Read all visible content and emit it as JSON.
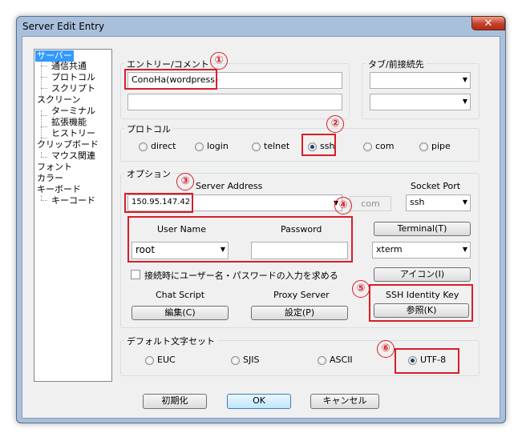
{
  "window": {
    "title": "Server Edit Entry",
    "close_symbol": "✕"
  },
  "tree": [
    {
      "label": "サーバー",
      "selected": true
    },
    {
      "label": "通信共通"
    },
    {
      "label": "プロトコル"
    },
    {
      "label": "スクリプト"
    },
    {
      "label": "スクリーン"
    },
    {
      "label": "ターミナル"
    },
    {
      "label": "拡張機能"
    },
    {
      "label": "ヒストリー"
    },
    {
      "label": "クリップボード"
    },
    {
      "label": "マウス関連"
    },
    {
      "label": "フォント"
    },
    {
      "label": "カラー"
    },
    {
      "label": "キーボード"
    },
    {
      "label": "キーコード"
    }
  ],
  "entry": {
    "group_label": "エントリー/コメント",
    "entry_value": "ConoHa(wordpress)",
    "comment_value": ""
  },
  "tab": {
    "group_label": "タブ/前接続先"
  },
  "protocol": {
    "group_label": "プロトコル",
    "options": [
      "direct",
      "login",
      "telnet",
      "ssh",
      "com",
      "pipe"
    ],
    "selected": "ssh"
  },
  "options": {
    "group_label": "オプション",
    "server_address_label": "Server Address",
    "server_address_value": "150.95.147.42",
    "com_label": "com",
    "socket_port_label": "Socket Port",
    "socket_port_value": "ssh",
    "username_label": "User Name",
    "username_value": "root",
    "password_label": "Password",
    "password_value": "",
    "terminal_button": "Terminal(T)",
    "terminal_value": "xterm",
    "icon_button": "アイコン(I)",
    "prompt_checkbox_label": "接続時にユーザー名・パスワードの入力を求める",
    "chat_script_label": "Chat Script",
    "chat_script_button": "編集(C)",
    "proxy_server_label": "Proxy Server",
    "proxy_server_button": "設定(P)",
    "ssh_key_label": "SSH Identity Key",
    "ssh_key_button": "参照(K)"
  },
  "charset": {
    "group_label": "デフォルト文字セット",
    "options": [
      "EUC",
      "SJIS",
      "ASCII",
      "UTF-8"
    ],
    "selected": "UTF-8"
  },
  "footer": {
    "init_button": "初期化",
    "ok_button": "OK",
    "cancel_button": "キャンセル"
  },
  "annotations": [
    "①",
    "②",
    "③",
    "④",
    "⑤",
    "⑥"
  ],
  "colors": {
    "highlight": "#d81e2a",
    "selection": "#3399ff"
  }
}
